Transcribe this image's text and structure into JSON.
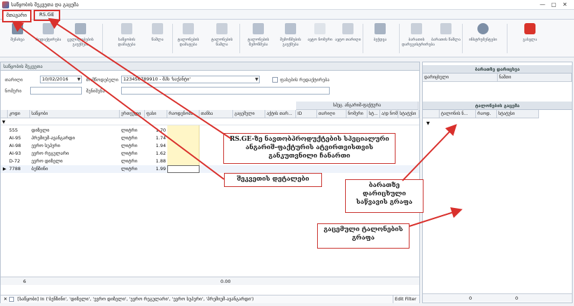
{
  "window": {
    "title": "საწყობის შეკვეთა და გაცემა"
  },
  "menu": {
    "tab_main": "მთავარი",
    "tab_rsge": "RS.GE"
  },
  "ribbon": {
    "buttons": [
      {
        "label": "შენახვა",
        "icon": "save-icon"
      },
      {
        "label": "რედაქტირება",
        "icon": "edit-icon"
      },
      {
        "label": "ცვლილებების გაუქმება",
        "icon": "undo-icon"
      },
      {
        "label": "საწყობის დამატება",
        "icon": "add-icon"
      },
      {
        "label": "წაშლა",
        "icon": "delete-icon"
      },
      {
        "label": "ტალონების დამატება",
        "icon": "add-icon"
      },
      {
        "label": "ტალონების წაშლა",
        "icon": "delete-icon"
      },
      {
        "label": "ტალონების შემოწმება",
        "icon": "check-icon"
      },
      {
        "label": "შემოწმების გაუქმება",
        "icon": "check-icon"
      },
      {
        "label": "ავტო ნომერი",
        "icon": "number-icon"
      },
      {
        "label": "ავტო თარიღი",
        "icon": "calendar-icon"
      },
      {
        "label": "ბეჭდვა",
        "icon": "print-icon"
      },
      {
        "label": "ბარათის დარეგისტრირება",
        "icon": "card-icon"
      },
      {
        "label": "ბარათის წაშლა",
        "icon": "card-delete-icon"
      },
      {
        "label": "ინსტრუმენტები",
        "icon": "gear-icon"
      },
      {
        "label": "გასვლა",
        "icon": "power-icon"
      }
    ]
  },
  "order_panel": {
    "title": "საწყობის შეკვეთა",
    "date_label": "თარიღი",
    "date_value": "10/02/2016",
    "supplier_label": "მომწოდებელი",
    "supplier_value": "123456789910 - შპს 'საქანტი'",
    "edit_label": "ფასების რედაქტირება",
    "number_label": "ნომერი",
    "note_label": "შენიშვნა"
  },
  "grid": {
    "columns": [
      "კოდი",
      "საწყობი",
      "ერთეული",
      "ფასი",
      "რაოდენობა",
      "თანხა",
      "გაცემული",
      "აქტის თარ...",
      "ID",
      "თარიღი",
      "ნომერი",
      "სტ...",
      "ა/დ ნომ...",
      "სტატუსი"
    ],
    "group_header": "სპეც. ანგარიშ-ფაქტურა",
    "rows": [
      {
        "code": "555",
        "name": "დიზელი",
        "unit": "ლიტრი",
        "price": "1.70"
      },
      {
        "code": "AI-95",
        "name": "პრემიუმ-ავანგარდი",
        "unit": "ლიტრი",
        "price": "1.74"
      },
      {
        "code": "AI-98",
        "name": "ევრო სუპერი",
        "unit": "ლიტრი",
        "price": "1.94"
      },
      {
        "code": "AI-93",
        "name": "ევრო რეგულარი",
        "unit": "ლიტრი",
        "price": "1.62"
      },
      {
        "code": "D-72",
        "name": "ევრო დიზელი",
        "unit": "ლიტრი",
        "price": "1.88"
      },
      {
        "code": "7788",
        "name": "ბენზინი",
        "unit": "ლიტრი",
        "price": "1.99"
      }
    ],
    "footer_count": "6",
    "footer_total": "0.00",
    "filter_text": "[საწყობი] In ('ბენზინი', 'დიზელი', 'ევრო დიზელი', 'ევრო რეგულარი', 'ევრო სუპერი', 'პრემიუმ-ავანგარდი')",
    "edit_filter": "Edit Filter"
  },
  "right_panel": {
    "cards_title": "ბარათზე დარიცხვა",
    "cards_col1": "დარიცხული",
    "cards_col2": "ნაშთი",
    "coupons_title": "ტალონების გაცემა",
    "coupons_cols": [
      "ტალონის ნ...",
      "რაოდ.",
      "სტატუსი"
    ],
    "footer_left": "0",
    "footer_right": "0"
  },
  "callouts": {
    "rsge": "RS.GE-ზე ნავთობპროდუქტების სპეციალური ანგარიშ-ფაქტურის ატვირთვისთვის განკუთვნილი ჩანართი",
    "order_details": "შეკვეთის დეტალები",
    "card_grid": "ბარათზე დარიცხული საწვავის გრაფა",
    "coupon_grid": "გაცემული ტალონების გრაფა"
  }
}
